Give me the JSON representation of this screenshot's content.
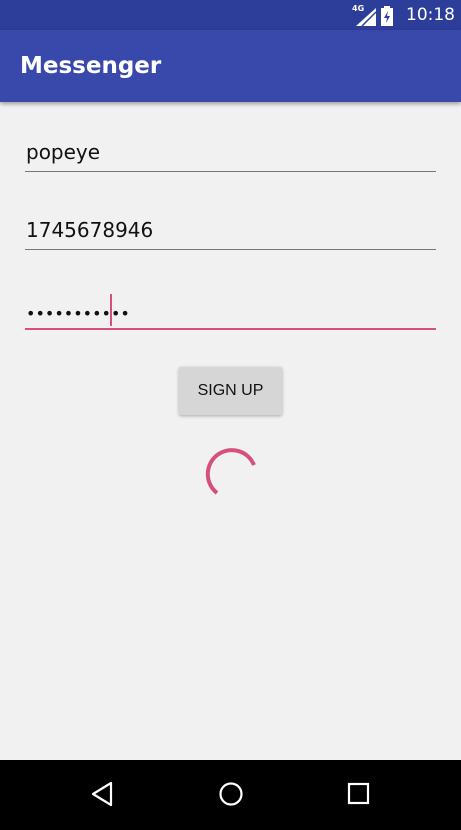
{
  "status_bar": {
    "network": "4G",
    "time": "10:18"
  },
  "app_bar": {
    "title": "Messenger"
  },
  "form": {
    "username": "popeye",
    "phone": "1745678946",
    "password": "•••••••••••"
  },
  "signup_button": {
    "label": "SIGN UP"
  },
  "colors": {
    "primary": "#3949ab",
    "primary_dark": "#2d3d9a",
    "accent": "#d6507c"
  },
  "icons": {
    "back": "back-icon",
    "home": "home-icon",
    "recents": "recents-icon"
  }
}
